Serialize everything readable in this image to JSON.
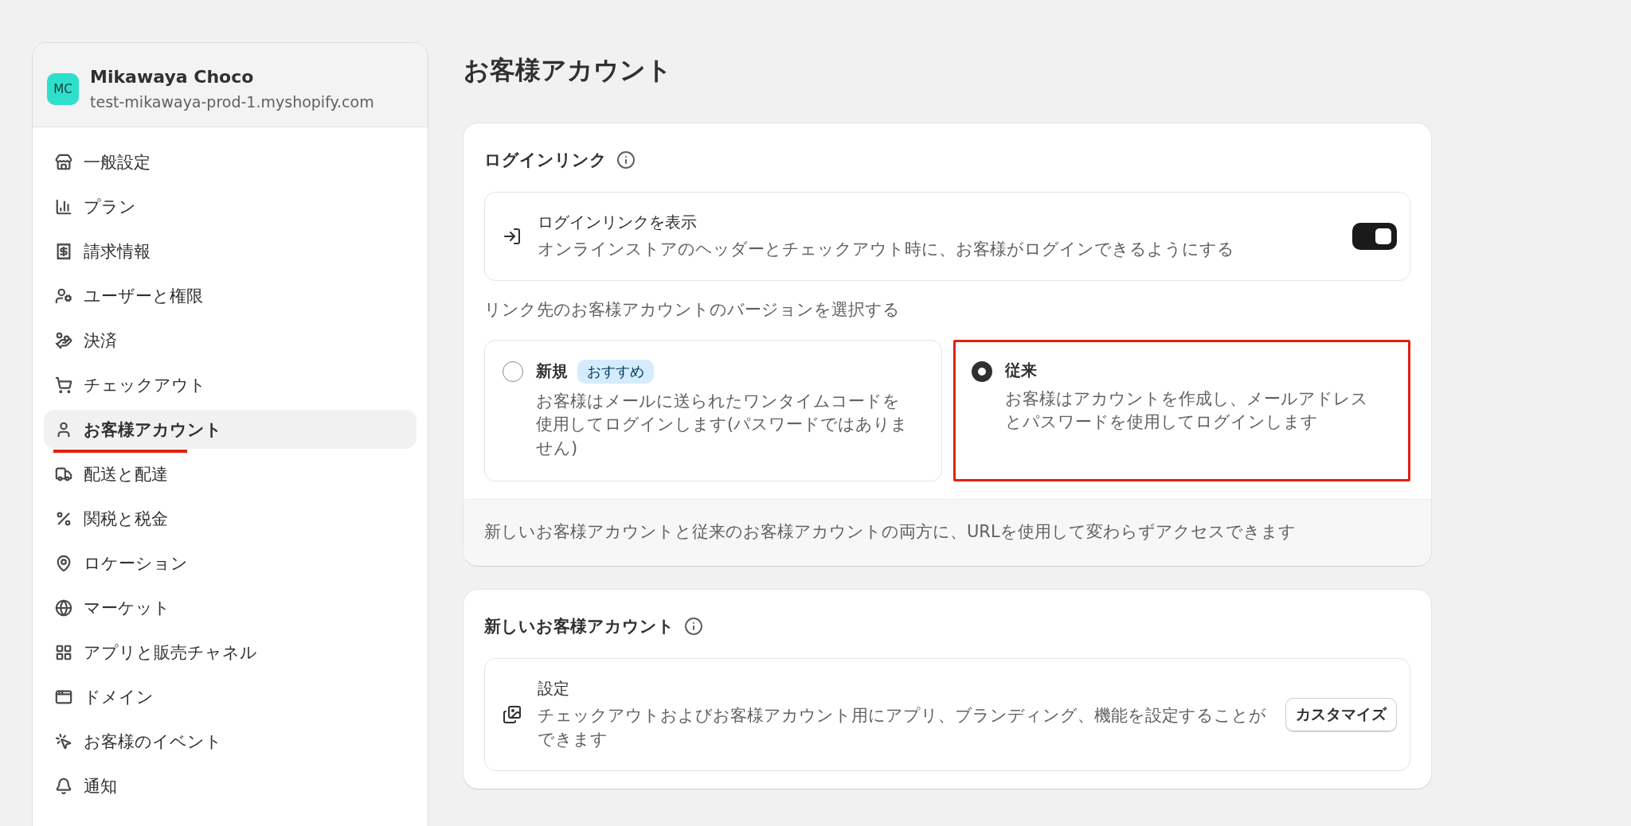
{
  "store": {
    "initials": "MC",
    "name": "Mikawaya Choco",
    "domain": "test-mikawaya-prod-1.myshopify.com"
  },
  "sidebar": {
    "items": [
      {
        "label": "一般設定",
        "selected": false,
        "underlined": false
      },
      {
        "label": "プラン",
        "selected": false,
        "underlined": false
      },
      {
        "label": "請求情報",
        "selected": false,
        "underlined": false
      },
      {
        "label": "ユーザーと権限",
        "selected": false,
        "underlined": false
      },
      {
        "label": "決済",
        "selected": false,
        "underlined": false
      },
      {
        "label": "チェックアウト",
        "selected": false,
        "underlined": false
      },
      {
        "label": "お客様アカウント",
        "selected": true,
        "underlined": true
      },
      {
        "label": "配送と配達",
        "selected": false,
        "underlined": false
      },
      {
        "label": "関税と税金",
        "selected": false,
        "underlined": false
      },
      {
        "label": "ロケーション",
        "selected": false,
        "underlined": false
      },
      {
        "label": "マーケット",
        "selected": false,
        "underlined": false
      },
      {
        "label": "アプリと販売チャネル",
        "selected": false,
        "underlined": false
      },
      {
        "label": "ドメイン",
        "selected": false,
        "underlined": false
      },
      {
        "label": "お客様のイベント",
        "selected": false,
        "underlined": false
      },
      {
        "label": "通知",
        "selected": false,
        "underlined": false
      }
    ]
  },
  "page_title": "お客様アカウント",
  "login_link_card": {
    "title": "ログインリンク",
    "setting": {
      "title": "ログインリンクを表示",
      "description": "オンラインストアのヘッダーとチェックアウト時に、お客様がログインできるようにする",
      "on": true
    },
    "version_prompt": "リンク先のお客様アカウントのバージョンを選択する",
    "options": [
      {
        "title": "新規",
        "badge": "おすすめ",
        "description": "お客様はメールに送られたワンタイムコードを使用してログインします(パスワードではありません)",
        "selected": false,
        "highlighted": false
      },
      {
        "title": "従来",
        "description": "お客様はアカウントを作成し、メールアドレスとパスワードを使用してログインします",
        "selected": true,
        "highlighted": true
      }
    ],
    "footer": "新しいお客様アカウントと従来のお客様アカウントの両方に、URLを使用して変わらずアクセスできます"
  },
  "new_accounts_card": {
    "title": "新しいお客様アカウント",
    "setting": {
      "title": "設定",
      "description": "チェックアウトおよびお客様アカウント用にアプリ、ブランディング、機能を設定することができます",
      "button": "カスタマイズ"
    }
  }
}
